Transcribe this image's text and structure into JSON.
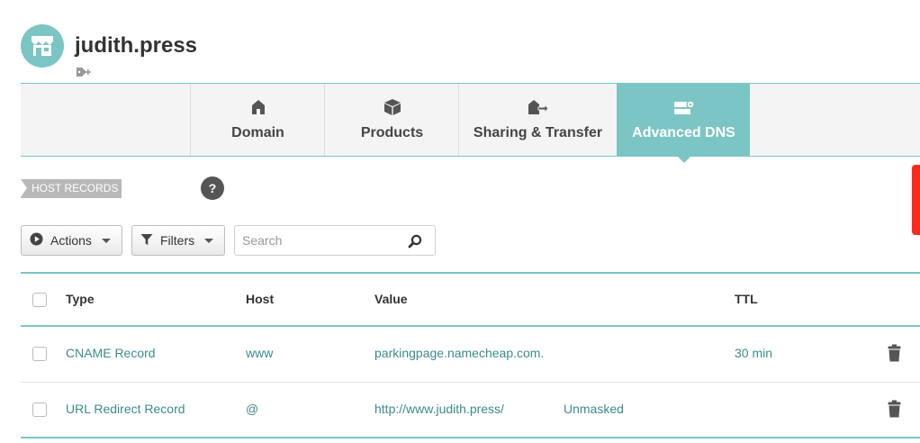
{
  "header": {
    "domain_name": "judith.press",
    "avatar_icon": "storefront-icon",
    "tag_icon": "tag-add-icon"
  },
  "tabs": [
    {
      "label": "Domain",
      "icon": "home-icon",
      "active": false
    },
    {
      "label": "Products",
      "icon": "box-icon",
      "active": false
    },
    {
      "label": "Sharing & Transfer",
      "icon": "house-arrow-icon",
      "active": false
    },
    {
      "label": "Advanced DNS",
      "icon": "server-gear-icon",
      "active": true
    }
  ],
  "section": {
    "label": "HOST RECORDS",
    "help_label": "?"
  },
  "toolbar": {
    "actions_label": "Actions",
    "filters_label": "Filters",
    "search_placeholder": "Search"
  },
  "table": {
    "columns": {
      "type": "Type",
      "host": "Host",
      "value": "Value",
      "ttl": "TTL"
    },
    "rows": [
      {
        "type": "CNAME Record",
        "host": "www",
        "value": "parkingpage.namecheap.com.",
        "extra": "",
        "ttl": "30 min"
      },
      {
        "type": "URL Redirect Record",
        "host": "@",
        "value": "http://www.judith.press/",
        "extra": "Unmasked",
        "ttl": ""
      }
    ]
  },
  "colors": {
    "accent": "#7cc5c5",
    "link": "#3d8b8b",
    "alert": "#ff2a1a"
  }
}
